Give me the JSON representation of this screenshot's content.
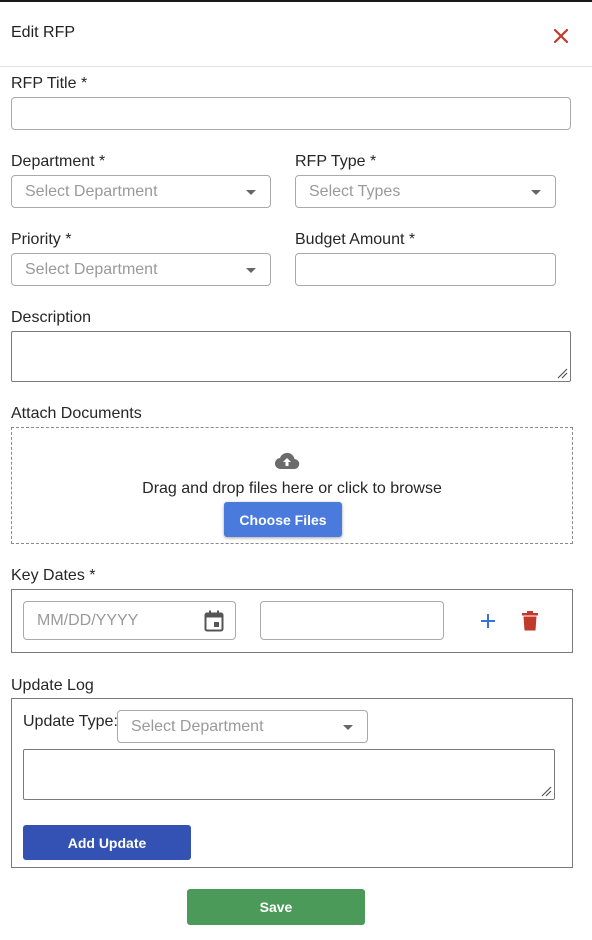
{
  "header": {
    "title": "Edit RFP",
    "close_icon": "close-icon"
  },
  "fields": {
    "rfp_title": {
      "label": "RFP Title *",
      "value": ""
    },
    "department": {
      "label": "Department *",
      "placeholder": "Select Department"
    },
    "rfp_type": {
      "label": "RFP Type *",
      "placeholder": "Select Types"
    },
    "priority": {
      "label": "Priority *",
      "placeholder": "Select Department"
    },
    "budget_amount": {
      "label": "Budget Amount *",
      "value": ""
    },
    "description": {
      "label": "Description",
      "value": ""
    }
  },
  "attachments": {
    "label": "Attach Documents",
    "hint": "Drag and drop files here or click to browse",
    "choose_button": "Choose Files",
    "icon": "cloud-upload-icon"
  },
  "key_dates": {
    "label": "Key Dates *",
    "date_placeholder": "MM/DD/YYYY",
    "description_value": "",
    "icons": [
      "calendar-icon",
      "plus-icon",
      "trash-icon"
    ]
  },
  "update_log": {
    "label": "Update Log",
    "type_label": "Update Type:",
    "type_placeholder": "Select Department",
    "note_value": "",
    "add_button": "Add Update"
  },
  "save_button": "Save",
  "colors": {
    "close": "#c0392b",
    "choose_button": "#4a7bdc",
    "add_update_button": "#3452b4",
    "save_button": "#4c9a5a",
    "plus": "#3a6fd8",
    "trash": "#c0392b"
  }
}
